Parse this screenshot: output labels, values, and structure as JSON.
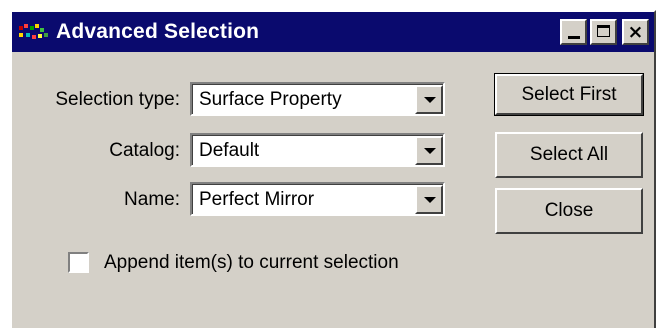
{
  "window": {
    "title": "Advanced Selection",
    "app_icon": "app-icon",
    "controls": {
      "minimize": "minimize-icon",
      "maximize": "maximize-icon",
      "close": "×"
    }
  },
  "fields": {
    "selection_type": {
      "label": "Selection type:",
      "value": "Surface Property"
    },
    "catalog": {
      "label": "Catalog:",
      "value": "Default"
    },
    "name": {
      "label": "Name:",
      "value": "Perfect Mirror"
    }
  },
  "buttons": {
    "select_first": "Select First",
    "select_all": "Select All",
    "close": "Close"
  },
  "append": {
    "label": "Append item(s) to current selection",
    "checked": false
  },
  "colors": {
    "titlebar": "#0a0a6e",
    "face": "#d4d0c8"
  }
}
